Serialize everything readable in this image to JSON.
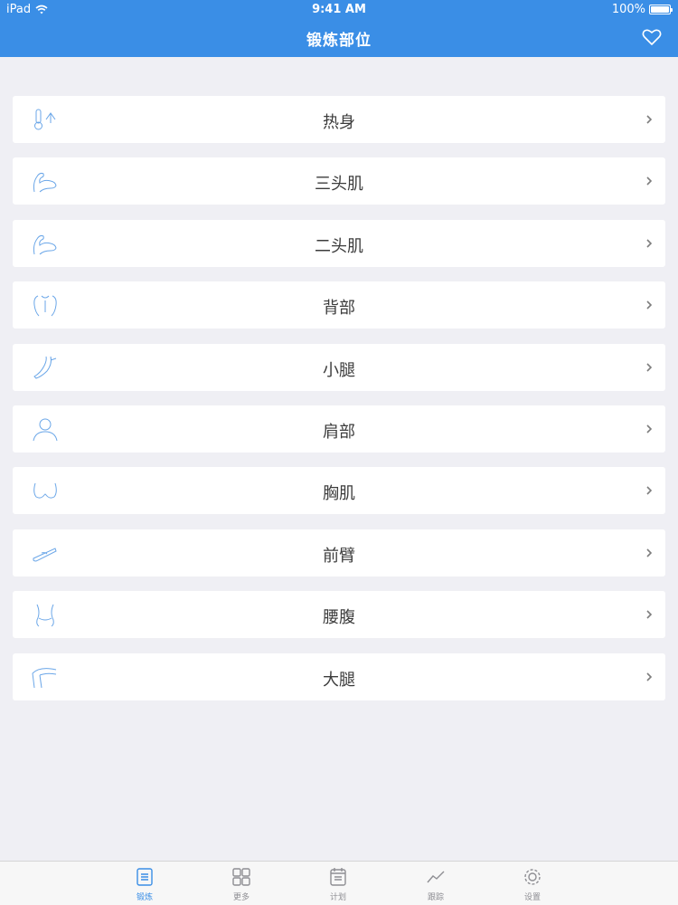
{
  "status": {
    "device": "iPad",
    "time": "9:41 AM",
    "battery": "100%",
    "battery_level": 1.0
  },
  "nav": {
    "title": "锻炼部位",
    "right_icon": "heart-icon"
  },
  "colors": {
    "accent": "#3a8ee6",
    "background": "#efeff4",
    "icon_stroke": "#6aa6e8"
  },
  "body_parts": [
    {
      "label": "热身",
      "icon": "thermometer-icon"
    },
    {
      "label": "三头肌",
      "icon": "arm-flex-icon"
    },
    {
      "label": "二头肌",
      "icon": "arm-flex-icon"
    },
    {
      "label": "背部",
      "icon": "back-torso-icon"
    },
    {
      "label": "小腿",
      "icon": "calf-icon"
    },
    {
      "label": "肩部",
      "icon": "shoulder-person-icon"
    },
    {
      "label": "胸肌",
      "icon": "chest-icon"
    },
    {
      "label": "前臂",
      "icon": "forearm-icon"
    },
    {
      "label": "腰腹",
      "icon": "waist-icon"
    },
    {
      "label": "大腿",
      "icon": "thigh-icon"
    }
  ],
  "tabs": [
    {
      "label": "锻炼",
      "icon": "list-icon",
      "active": true
    },
    {
      "label": "更多",
      "icon": "grid-icon",
      "active": false
    },
    {
      "label": "计划",
      "icon": "calendar-icon",
      "active": false
    },
    {
      "label": "跟踪",
      "icon": "chart-line-icon",
      "active": false
    },
    {
      "label": "设置",
      "icon": "gear-icon",
      "active": false
    }
  ]
}
